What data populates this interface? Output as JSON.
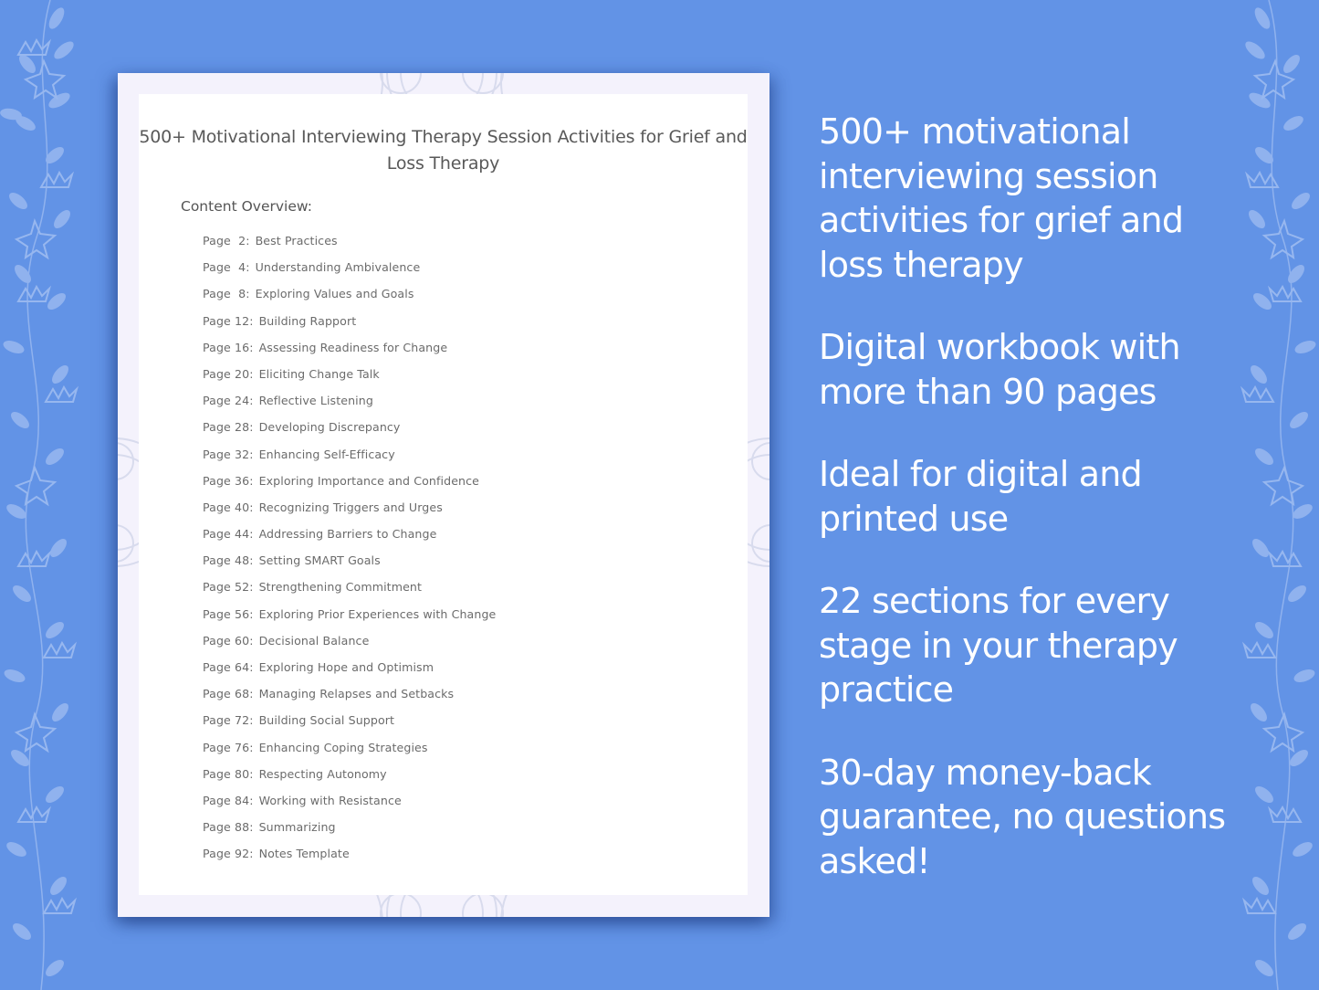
{
  "colors": {
    "background": "#6293e6",
    "floral": "#a9c4f2",
    "card_frame": "#f4f2fc",
    "card_panel": "#ffffff",
    "doc_text": "#595959",
    "feature_text": "#ffffff"
  },
  "document": {
    "title": "500+ Motivational Interviewing Therapy Session Activities for Grief and Loss Therapy",
    "overview_label": "Content Overview:",
    "toc": [
      {
        "page": "Page  2:",
        "title": "Best Practices"
      },
      {
        "page": "Page  4:",
        "title": "Understanding Ambivalence"
      },
      {
        "page": "Page  8:",
        "title": "Exploring Values and Goals"
      },
      {
        "page": "Page 12:",
        "title": "Building Rapport"
      },
      {
        "page": "Page 16:",
        "title": "Assessing Readiness for Change"
      },
      {
        "page": "Page 20:",
        "title": "Eliciting Change Talk"
      },
      {
        "page": "Page 24:",
        "title": "Reflective Listening"
      },
      {
        "page": "Page 28:",
        "title": "Developing Discrepancy"
      },
      {
        "page": "Page 32:",
        "title": "Enhancing Self-Efficacy"
      },
      {
        "page": "Page 36:",
        "title": "Exploring Importance and Confidence"
      },
      {
        "page": "Page 40:",
        "title": "Recognizing Triggers and Urges"
      },
      {
        "page": "Page 44:",
        "title": "Addressing Barriers to Change"
      },
      {
        "page": "Page 48:",
        "title": "Setting SMART Goals"
      },
      {
        "page": "Page 52:",
        "title": "Strengthening Commitment"
      },
      {
        "page": "Page 56:",
        "title": "Exploring Prior Experiences with Change"
      },
      {
        "page": "Page 60:",
        "title": "Decisional Balance"
      },
      {
        "page": "Page 64:",
        "title": "Exploring Hope and Optimism"
      },
      {
        "page": "Page 68:",
        "title": "Managing Relapses and Setbacks"
      },
      {
        "page": "Page 72:",
        "title": "Building Social Support"
      },
      {
        "page": "Page 76:",
        "title": "Enhancing Coping Strategies"
      },
      {
        "page": "Page 80:",
        "title": "Respecting Autonomy"
      },
      {
        "page": "Page 84:",
        "title": "Working with Resistance"
      },
      {
        "page": "Page 88:",
        "title": "Summarizing"
      },
      {
        "page": "Page 92:",
        "title": "Notes Template"
      }
    ]
  },
  "features": [
    "500+ motivational interviewing session activities for grief and loss therapy",
    "Digital workbook with more than 90 pages",
    "Ideal for digital and printed use",
    "22 sections for every stage in your therapy practice",
    "30-day money-back guarantee, no questions asked!"
  ],
  "icons": {
    "floral_border": "floral-vine-icon",
    "mandala": "mandala-ornament-icon"
  }
}
